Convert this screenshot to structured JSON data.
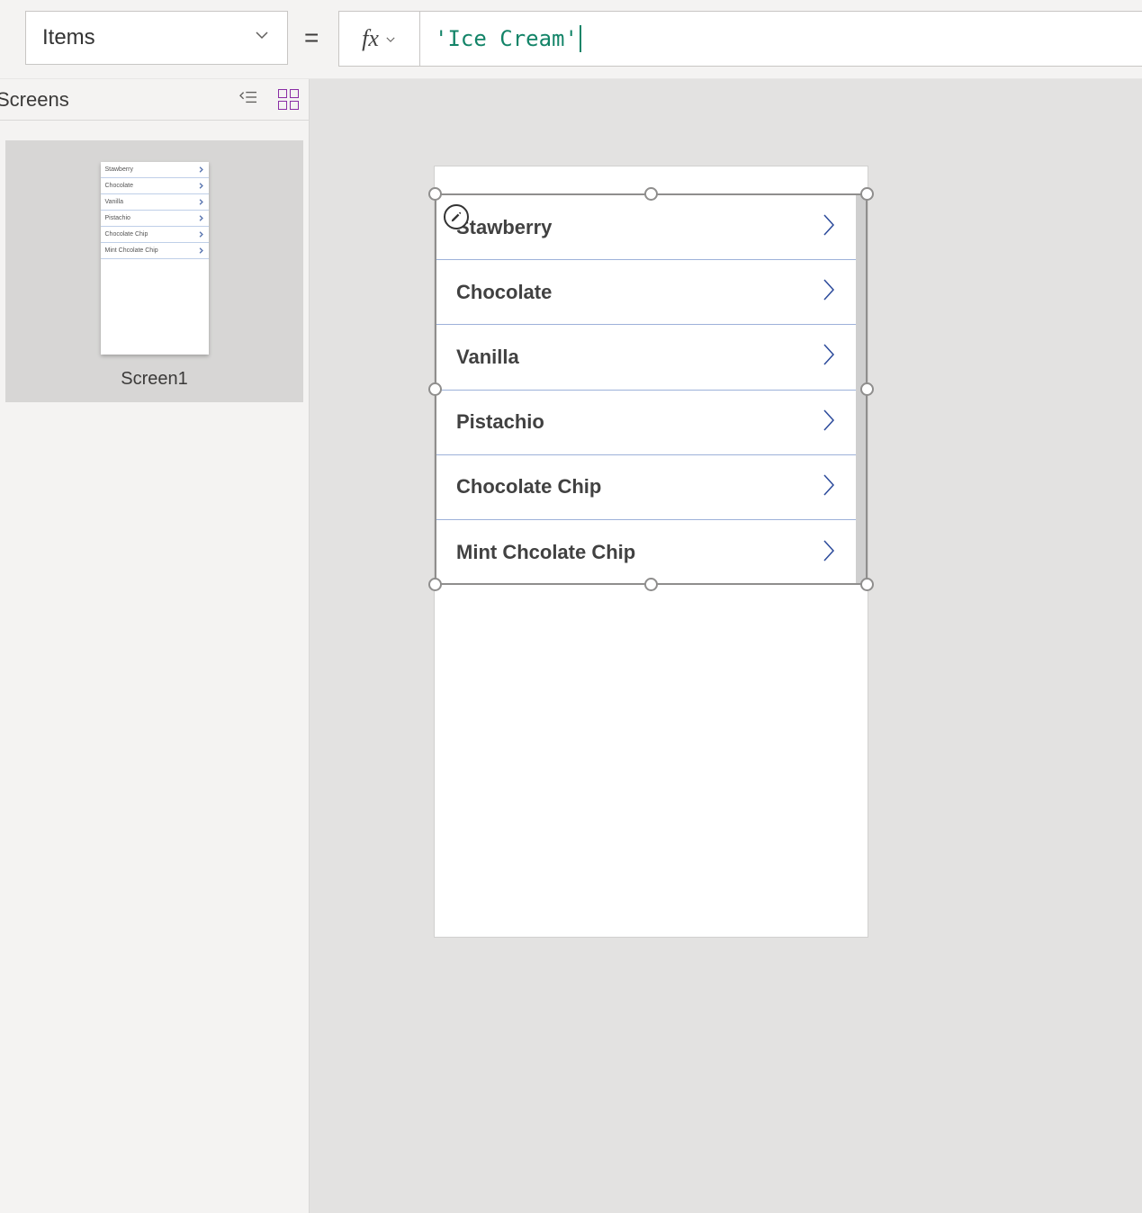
{
  "formula": {
    "property": "Items",
    "expressionDisplay": "'Ice Cream'"
  },
  "leftPane": {
    "title": "Screens",
    "selectedScreen": "Screen1"
  },
  "gallery": {
    "items": [
      "Stawberry",
      "Chocolate",
      "Vanilla",
      "Pistachio",
      "Chocolate Chip",
      "Mint Chcolate Chip"
    ]
  },
  "colors": {
    "accent": "#8a2da5",
    "rowDivider": "#9db1d9",
    "arrow": "#2b4a9b",
    "formulaText": "#138468"
  }
}
